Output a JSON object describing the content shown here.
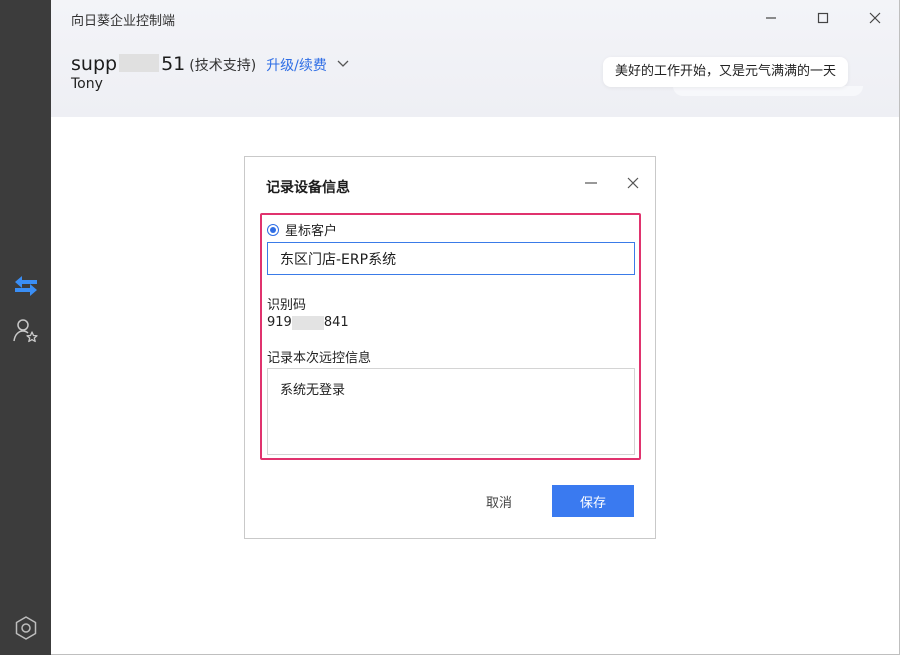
{
  "app": {
    "title": "向日葵企业控制端"
  },
  "colors": {
    "accent": "#2f6ee5",
    "highlight": "#e0336e",
    "sidebar": "#3c3c3c",
    "primary_button": "#3a7af0"
  },
  "sidebar": {
    "items": [
      {
        "icon": "remote-control-arrows-icon",
        "active": true
      },
      {
        "icon": "user-star-icon",
        "active": false
      }
    ],
    "bottom_icon": "hexagon-settings-icon"
  },
  "account": {
    "name_prefix": "supp",
    "name_suffix": "51",
    "role": "(技术支持)",
    "upgrade_label": "升级/续费",
    "display_name": "Tony"
  },
  "motto": "美好的工作开始，又是元气满满的一天",
  "dialog": {
    "title": "记录设备信息",
    "star_label": "星标客户",
    "name_value": "东区门店-ERP系统",
    "id_label": "识别码",
    "id_prefix": "919",
    "id_suffix": "841",
    "memo_label": "记录本次远控信息",
    "memo_value": "系统无登录",
    "cancel_label": "取消",
    "save_label": "保存"
  }
}
